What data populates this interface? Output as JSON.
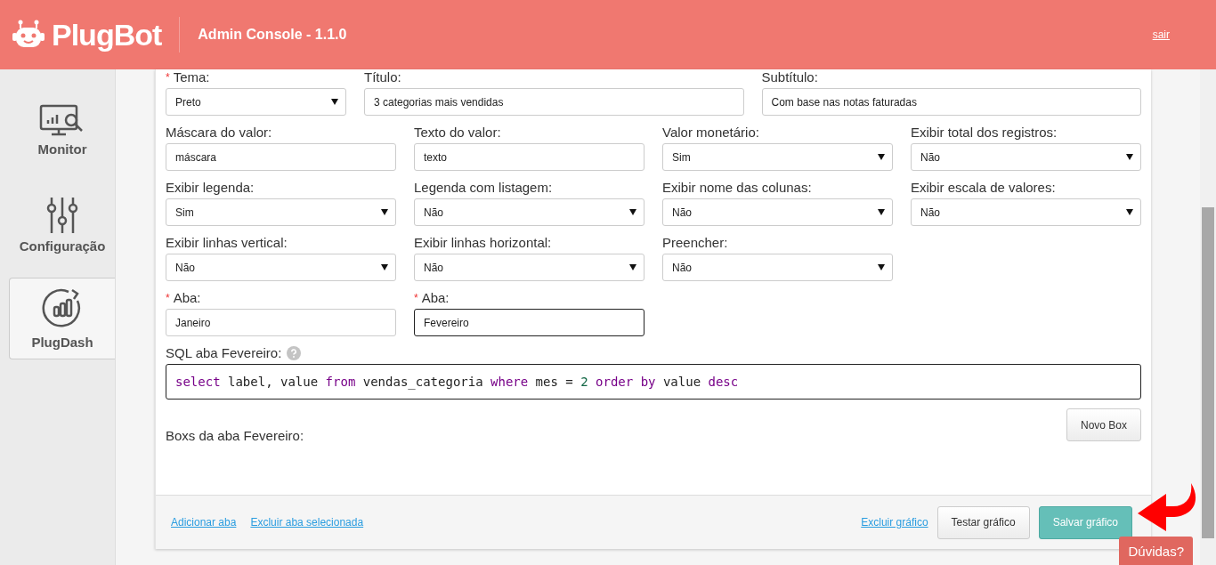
{
  "header": {
    "logo": "PlugBot",
    "title": "Admin Console - 1.1.0",
    "logout": "sair"
  },
  "sidebar": {
    "items": [
      {
        "label": "Monitor",
        "selected": false
      },
      {
        "label": "Configuração",
        "selected": false
      },
      {
        "label": "PlugDash",
        "selected": true
      }
    ]
  },
  "form": {
    "rows": [
      {
        "fields": [
          {
            "label": "Tema:",
            "required_mark": "*",
            "kind": "select",
            "value": "Preto",
            "focused": false
          },
          {
            "label": "Título:",
            "kind": "input",
            "value": "3 categorias mais vendidas",
            "focused": false
          },
          {
            "label": "Subtítulo:",
            "kind": "input",
            "value": "Com base nas notas faturadas",
            "focused": false
          }
        ]
      },
      {
        "fields": [
          {
            "label": "Máscara do valor:",
            "kind": "input",
            "value": "máscara",
            "focused": false
          },
          {
            "label": "Texto do valor:",
            "kind": "input",
            "value": "texto",
            "focused": false
          },
          {
            "label": "Valor monetário:",
            "kind": "select",
            "value": "Sim",
            "focused": false
          },
          {
            "label": "Exibir total dos registros:",
            "kind": "select",
            "value": "Não",
            "focused": false
          }
        ]
      },
      {
        "fields": [
          {
            "label": "Exibir legenda:",
            "kind": "select",
            "value": "Sim",
            "focused": false
          },
          {
            "label": "Legenda com listagem:",
            "kind": "select",
            "value": "Não",
            "focused": false
          },
          {
            "label": "Exibir nome das colunas:",
            "kind": "select",
            "value": "Não",
            "focused": false
          },
          {
            "label": "Exibir escala de valores:",
            "kind": "select",
            "value": "Não",
            "focused": false
          }
        ]
      },
      {
        "fields": [
          {
            "label": "Exibir linhas vertical:",
            "kind": "select",
            "value": "Não",
            "focused": false
          },
          {
            "label": "Exibir linhas horizontal:",
            "kind": "select",
            "value": "Não",
            "focused": false
          },
          {
            "label": "Preencher:",
            "kind": "select",
            "value": "Não",
            "focused": false
          }
        ]
      },
      {
        "fields": [
          {
            "label": "Aba:",
            "required_mark": "*",
            "kind": "input",
            "value": "Janeiro",
            "focused": false
          },
          {
            "label": "Aba:",
            "required_mark": "*",
            "kind": "input",
            "value": "Fevereiro",
            "focused": true
          }
        ]
      }
    ],
    "sql": {
      "label": "SQL aba Fevereiro:",
      "tokens": [
        {
          "text": "select",
          "kind": "keyword"
        },
        {
          "text": " label, value ",
          "kind": "plain"
        },
        {
          "text": "from",
          "kind": "keyword"
        },
        {
          "text": " vendas_categoria ",
          "kind": "plain"
        },
        {
          "text": "where",
          "kind": "keyword"
        },
        {
          "text": " mes = ",
          "kind": "plain"
        },
        {
          "text": "2",
          "kind": "number"
        },
        {
          "text": " order by",
          "kind": "keyword"
        },
        {
          "text": " value ",
          "kind": "plain"
        },
        {
          "text": "desc",
          "kind": "keyword"
        }
      ]
    },
    "boxes_label": "Boxs da aba Fevereiro:",
    "new_box_button": "Novo Box"
  },
  "footer": {
    "links_left": [
      "Adicionar aba",
      "Excluir aba selecionada"
    ],
    "delete_link": "Excluir gráfico",
    "test_button": "Testar gráfico",
    "save_button": "Salvar gráfico"
  },
  "help_button": "Dúvidas?"
}
